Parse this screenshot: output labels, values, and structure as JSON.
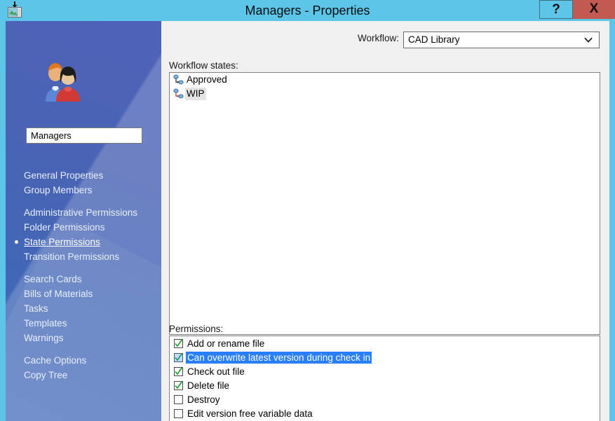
{
  "window": {
    "title": "Managers - Properties",
    "app_icon": "window-document-icon",
    "help_label": "?",
    "close_label": "X",
    "titlebar_color": "#5cc5e8",
    "close_color": "#c25a52"
  },
  "sidebar": {
    "group_icon": "users-group-icon",
    "name_value": "Managers",
    "items": [
      {
        "label": "General Properties",
        "active": false,
        "gap_before": false
      },
      {
        "label": "Group Members",
        "active": false,
        "gap_before": false
      },
      {
        "label": "Administrative Permissions",
        "active": false,
        "gap_before": true
      },
      {
        "label": "Folder Permissions",
        "active": false,
        "gap_before": false
      },
      {
        "label": "State Permissions",
        "active": true,
        "gap_before": false
      },
      {
        "label": "Transition Permissions",
        "active": false,
        "gap_before": false
      },
      {
        "label": "Search Cards",
        "active": false,
        "gap_before": true
      },
      {
        "label": "Bills of Materials",
        "active": false,
        "gap_before": false
      },
      {
        "label": "Tasks",
        "active": false,
        "gap_before": false
      },
      {
        "label": "Templates",
        "active": false,
        "gap_before": false
      },
      {
        "label": "Warnings",
        "active": false,
        "gap_before": false
      },
      {
        "label": "Cache Options",
        "active": false,
        "gap_before": true
      },
      {
        "label": "Copy Tree",
        "active": false,
        "gap_before": false
      }
    ]
  },
  "main": {
    "workflow": {
      "label": "Workflow:",
      "value": "CAD Library",
      "chevron_icon": "chevron-down-icon"
    },
    "states": {
      "label": "Workflow states:",
      "items": [
        {
          "name": "Approved",
          "icon": "workflow-state-icon",
          "focused": false
        },
        {
          "name": "WIP",
          "icon": "workflow-state-icon",
          "focused": true
        }
      ]
    },
    "permissions": {
      "label": "Permissions:",
      "check_color": "#1a9e2e",
      "selection_color": "#2a7fff",
      "items": [
        {
          "name": "Add or rename file",
          "checked": true,
          "selected": false
        },
        {
          "name": "Can overwrite latest version during check in",
          "checked": true,
          "selected": true
        },
        {
          "name": "Check out file",
          "checked": true,
          "selected": false
        },
        {
          "name": "Delete file",
          "checked": true,
          "selected": false
        },
        {
          "name": "Destroy",
          "checked": false,
          "selected": false
        },
        {
          "name": "Edit version free variable data",
          "checked": false,
          "selected": false
        }
      ]
    }
  }
}
